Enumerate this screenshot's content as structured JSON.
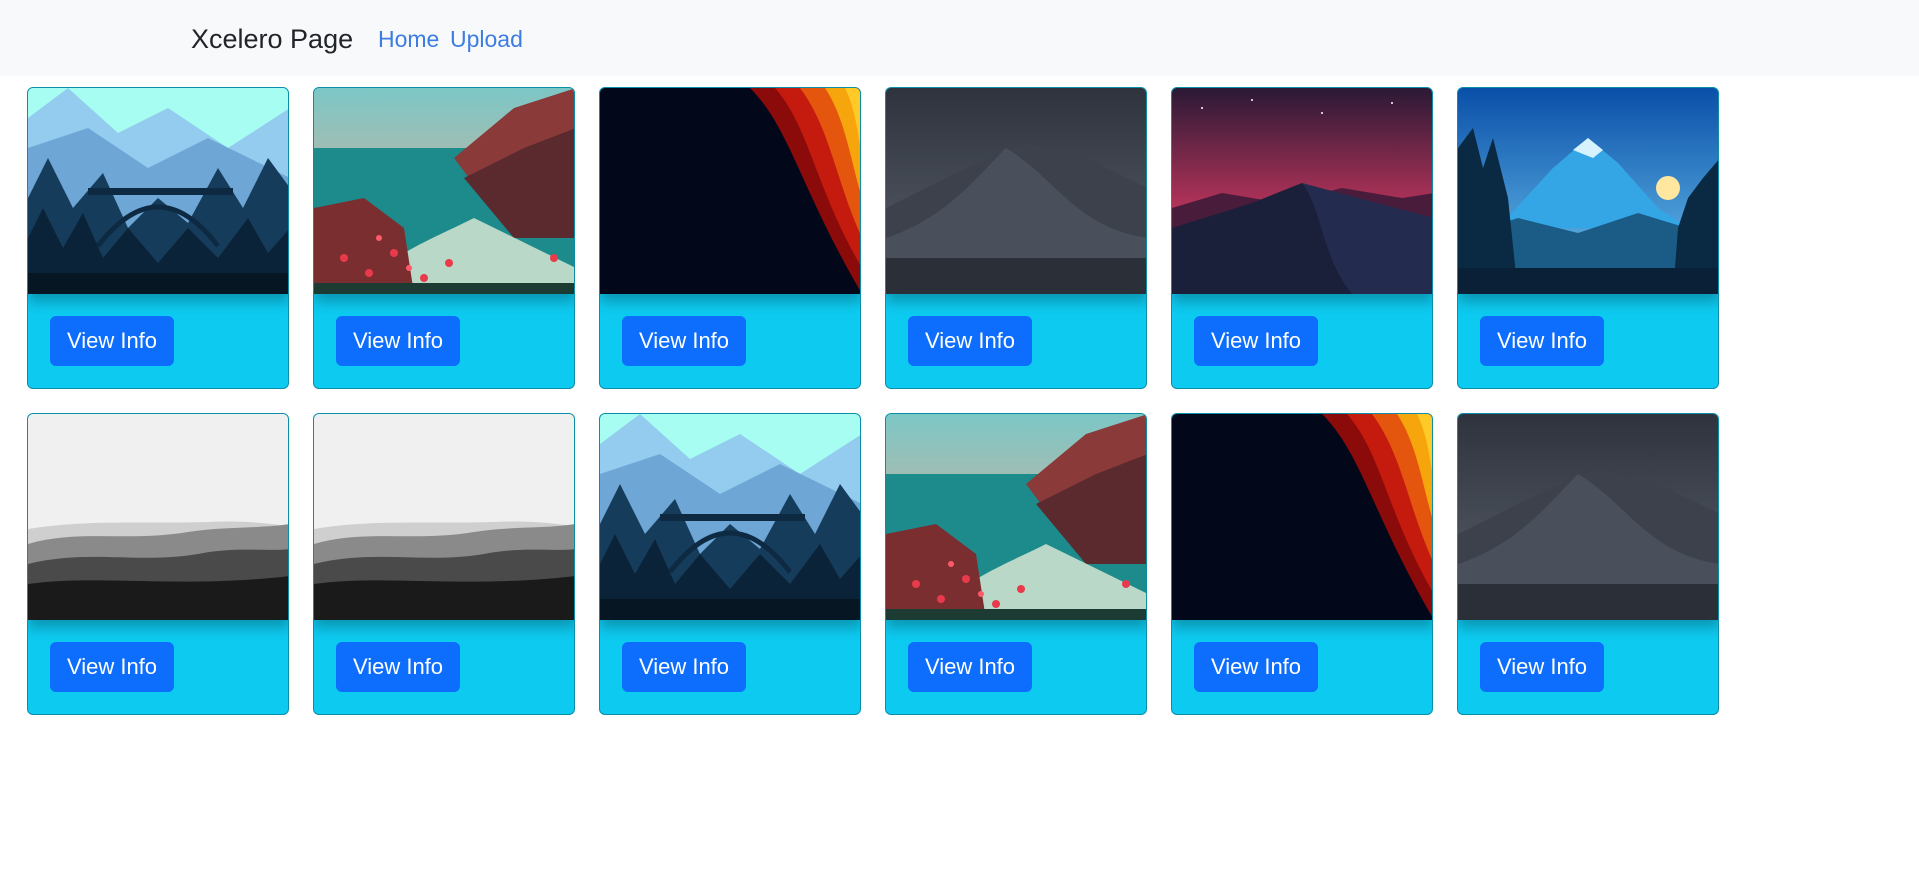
{
  "navbar": {
    "brand": "Xcelero Page",
    "links": [
      "Home",
      "Upload"
    ]
  },
  "cards": {
    "button_label": "View Info",
    "images": [
      "bridge-landscape",
      "coast-flowers",
      "dark-red-wave",
      "grey-dunes",
      "red-sky-dunes",
      "blue-mountain-sunrise",
      "grey-hills",
      "grey-hills",
      "bridge-landscape",
      "coast-flowers",
      "dark-red-wave",
      "grey-dunes"
    ]
  }
}
